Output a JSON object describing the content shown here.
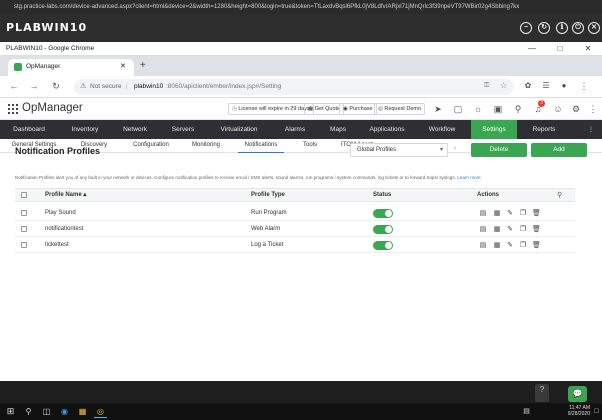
{
  "vm": {
    "url": "stg.practice-labs.com/device-advanced.aspx?client=html&device=2&width=1280&height=800&login=true&token=TtLaxdvBqsl6PfkL0jV8LdfvrARjxl71jMnQrlc3f39npeVT97WBir02g4Sbbing7kx",
    "title": "PLABWIN10",
    "icons": [
      "−",
      "↻",
      "ℹ",
      "⏻",
      "✕"
    ]
  },
  "window": {
    "title": "PLABWIN10 - Google Chrome",
    "controls": [
      "—",
      "□",
      "✕"
    ]
  },
  "browser": {
    "tab_title": "OpManager",
    "tab_close": "✕",
    "new_tab": "+",
    "not_secure": "Not secure",
    "url_host": "plabwin10",
    "url_rest": ":8060/apiclient/ember/index.jsp#/Setting",
    "nav_back": "←",
    "nav_forward": "→",
    "nav_reload": "↻"
  },
  "app": {
    "brand": "OpManager",
    "license": "License will expire in 29 days",
    "get_quote": "Get Quote",
    "purchase": "Purchase",
    "request_demo": "Request Demo",
    "badge_count": "3",
    "main_nav": [
      "Dashboard",
      "Inventory",
      "Network",
      "Servers",
      "Virtualization",
      "Alarms",
      "Maps",
      "Applications",
      "Workflow",
      "Settings",
      "Reports"
    ],
    "sub_nav": [
      "General Settings",
      "Discovery",
      "Configuration",
      "Monitoring",
      "Notifications",
      "Tools",
      "ITOM Agent"
    ]
  },
  "page": {
    "title": "Notification Profiles",
    "profile_select": "Global Profiles",
    "delete_label": "Delete",
    "add_label": "Add",
    "description": "Notification Profiles alert you of any fault in your network or devices. Configure notification profiles to receive email / SMS alerts, sound alarms, run programs / system commands, log tickets or to forward traps/ syslogs.",
    "learn_more": "Learn more"
  },
  "table": {
    "headers": [
      "Profile Name ▴",
      "Profile Type",
      "Status",
      "Actions"
    ],
    "rows": [
      {
        "name": "Play Sound",
        "type": "Run Program"
      },
      {
        "name": "notificationtest",
        "type": "Web Alarm"
      },
      {
        "name": "tickettest",
        "type": "Log a Ticket"
      }
    ]
  },
  "desktop": {
    "help": "?",
    "chat": "💬"
  },
  "taskbar": {
    "time": "11:47 AM",
    "date": "9/28/2020"
  },
  "colors": {
    "accent": "#3aa651",
    "nav_bg": "#2e2e33",
    "link": "#2a7bd1"
  }
}
